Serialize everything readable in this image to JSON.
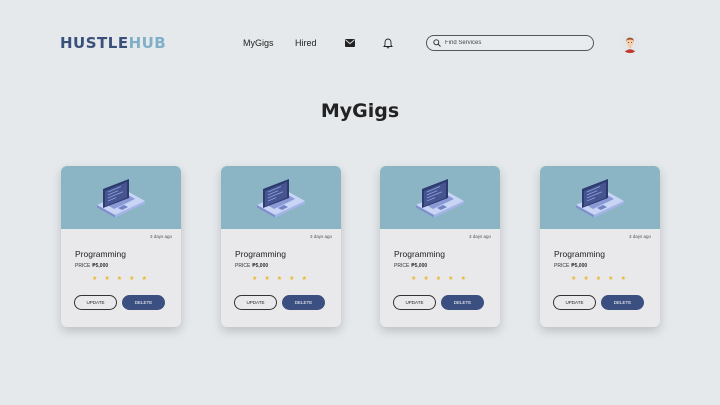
{
  "brand": {
    "part1": "HUSTLE",
    "part2": "HUB"
  },
  "nav": {
    "mygigs": "MyGigs",
    "hired": "Hired"
  },
  "icons": {
    "mail": "mail-icon",
    "bell": "bell-icon",
    "search": "search-icon",
    "avatar": "avatar-icon",
    "laptop": "laptop-icon"
  },
  "search": {
    "placeholder": "Find Services",
    "value": ""
  },
  "page": {
    "title": "MyGigs"
  },
  "cards": [
    {
      "date": "3 days ago",
      "title": "Programming",
      "price_label": "PRICE",
      "price": "₱5,000",
      "rating": 5,
      "update": "UPDATE",
      "delete": "DELETE"
    },
    {
      "date": "3 days ago",
      "title": "Programming",
      "price_label": "PRICE",
      "price": "₱5,000",
      "rating": 5,
      "update": "UPDATE",
      "delete": "DELETE"
    },
    {
      "date": "3 days ago",
      "title": "Programming",
      "price_label": "PRICE",
      "price": "₱5,000",
      "rating": 5,
      "update": "UPDATE",
      "delete": "DELETE"
    },
    {
      "date": "3 days ago",
      "title": "Programming",
      "price_label": "PRICE",
      "price": "₱5,000",
      "rating": 5,
      "update": "UPDATE",
      "delete": "DELETE"
    }
  ],
  "colors": {
    "background": "#e5e9ec",
    "brand_dark": "#3a4f7a",
    "brand_light": "#7fb0c8",
    "card_image": "#8bb4c5",
    "delete_button": "#3b4f80",
    "star": "#e8b92a"
  }
}
